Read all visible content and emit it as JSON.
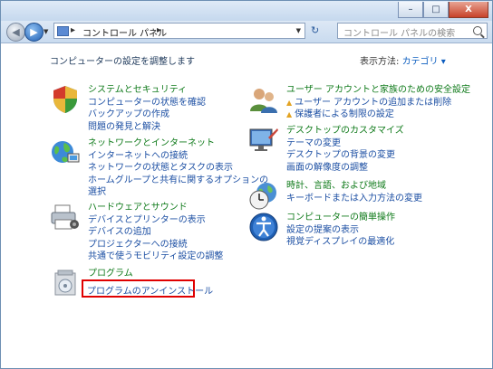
{
  "window": {
    "buttons": {
      "minimize": "–",
      "maximize": "□",
      "close": "X"
    }
  },
  "nav": {
    "back_icon": "back-arrow-icon",
    "forward_icon": "forward-arrow-icon",
    "breadcrumb": {
      "sep1": "▸",
      "label": "コントロール パネル",
      "sep2": "▸"
    },
    "refresh": "↻",
    "search_placeholder": "コントロール パネルの検索"
  },
  "content": {
    "heading": "コンピューターの設定を調整します",
    "view_by_label": "表示方法:",
    "view_by_value": "カテゴリ ▾"
  },
  "left_categories": [
    {
      "title": "システムとセキュリティ",
      "links": [
        "コンピューターの状態を確認",
        "バックアップの作成",
        "問題の発見と解決"
      ]
    },
    {
      "title": "ネットワークとインターネット",
      "links": [
        "インターネットへの接続",
        "ネットワークの状態とタスクの表示",
        "ホームグループと共有に関するオプションの",
        "選択"
      ]
    },
    {
      "title": "ハードウェアとサウンド",
      "links": [
        "デバイスとプリンターの表示",
        "デバイスの追加",
        "プロジェクターへの接続",
        "共通で使うモビリティ設定の調整"
      ]
    },
    {
      "title": "プログラム",
      "links": [
        "プログラムのアンインストール"
      ]
    }
  ],
  "right_categories": [
    {
      "title": "ユーザー アカウントと家族のための安全設定",
      "links": [
        "ユーザー アカウントの追加または削除",
        "保護者による制限の設定"
      ]
    },
    {
      "title": "デスクトップのカスタマイズ",
      "links": [
        "テーマの変更",
        "デスクトップの背景の変更",
        "画面の解像度の調整"
      ]
    },
    {
      "title": "時計、言語、および地域",
      "links": [
        "キーボードまたは入力方法の変更"
      ]
    },
    {
      "title": "コンピューターの簡単操作",
      "links": [
        "設定の提案の表示",
        "視覚ディスプレイの最適化"
      ]
    }
  ],
  "colors": {
    "title_green": "#0f7a1a",
    "link_blue": "#1c4fa3",
    "highlight_red": "#e00000"
  }
}
